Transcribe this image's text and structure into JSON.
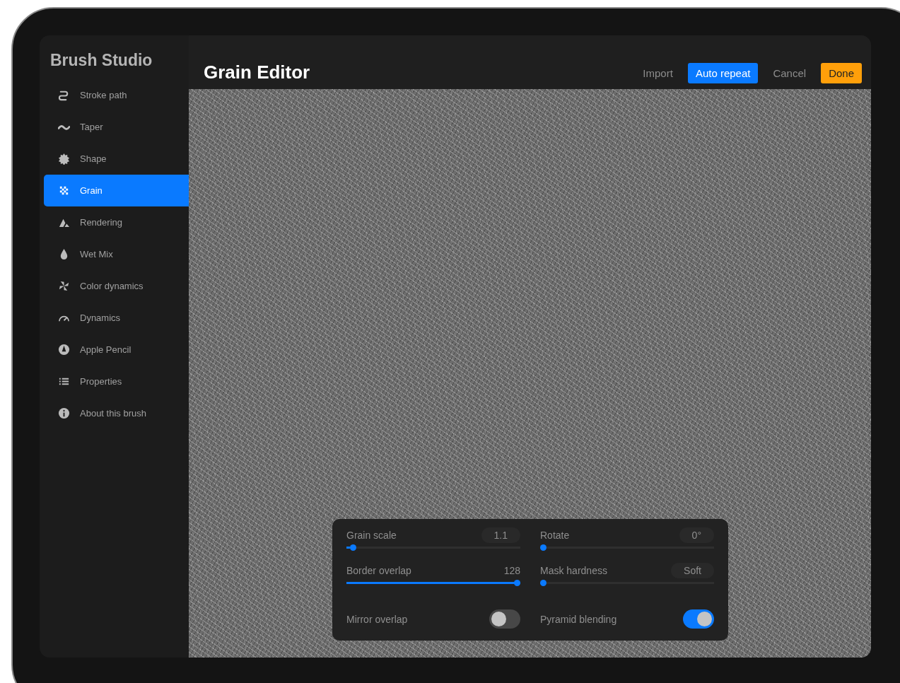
{
  "sidebar": {
    "title": "Brush Studio",
    "items": [
      {
        "label": "Stroke path",
        "selected": false
      },
      {
        "label": "Taper",
        "selected": false
      },
      {
        "label": "Shape",
        "selected": false
      },
      {
        "label": "Grain",
        "selected": true
      },
      {
        "label": "Rendering",
        "selected": false
      },
      {
        "label": "Wet Mix",
        "selected": false
      },
      {
        "label": "Color dynamics",
        "selected": false
      },
      {
        "label": "Dynamics",
        "selected": false
      },
      {
        "label": "Apple Pencil",
        "selected": false
      },
      {
        "label": "Properties",
        "selected": false
      },
      {
        "label": "About this brush",
        "selected": false
      }
    ]
  },
  "editor": {
    "title": "Grain Editor",
    "buttons": [
      {
        "label": "Import",
        "kind": "plain"
      },
      {
        "label": "Auto repeat",
        "kind": "toggle",
        "selected": true
      },
      {
        "label": "Cancel",
        "kind": "plain"
      },
      {
        "label": "Done",
        "kind": "primary"
      }
    ]
  },
  "settings": {
    "sliders": [
      {
        "label": "Grain scale",
        "value": "1.1",
        "boxed": true,
        "level": 0.02
      },
      {
        "label": "Rotate",
        "value": "0°",
        "boxed": true,
        "level": 0
      },
      {
        "label": "Border overlap",
        "value": "128",
        "boxed": false,
        "level": 1
      },
      {
        "label": "Mask hardness",
        "value": "Soft",
        "boxed": true,
        "level": 0
      }
    ],
    "toggles": [
      {
        "label": "Mirror overlap",
        "on": false
      },
      {
        "label": "Pyramid blending",
        "on": true
      }
    ]
  }
}
